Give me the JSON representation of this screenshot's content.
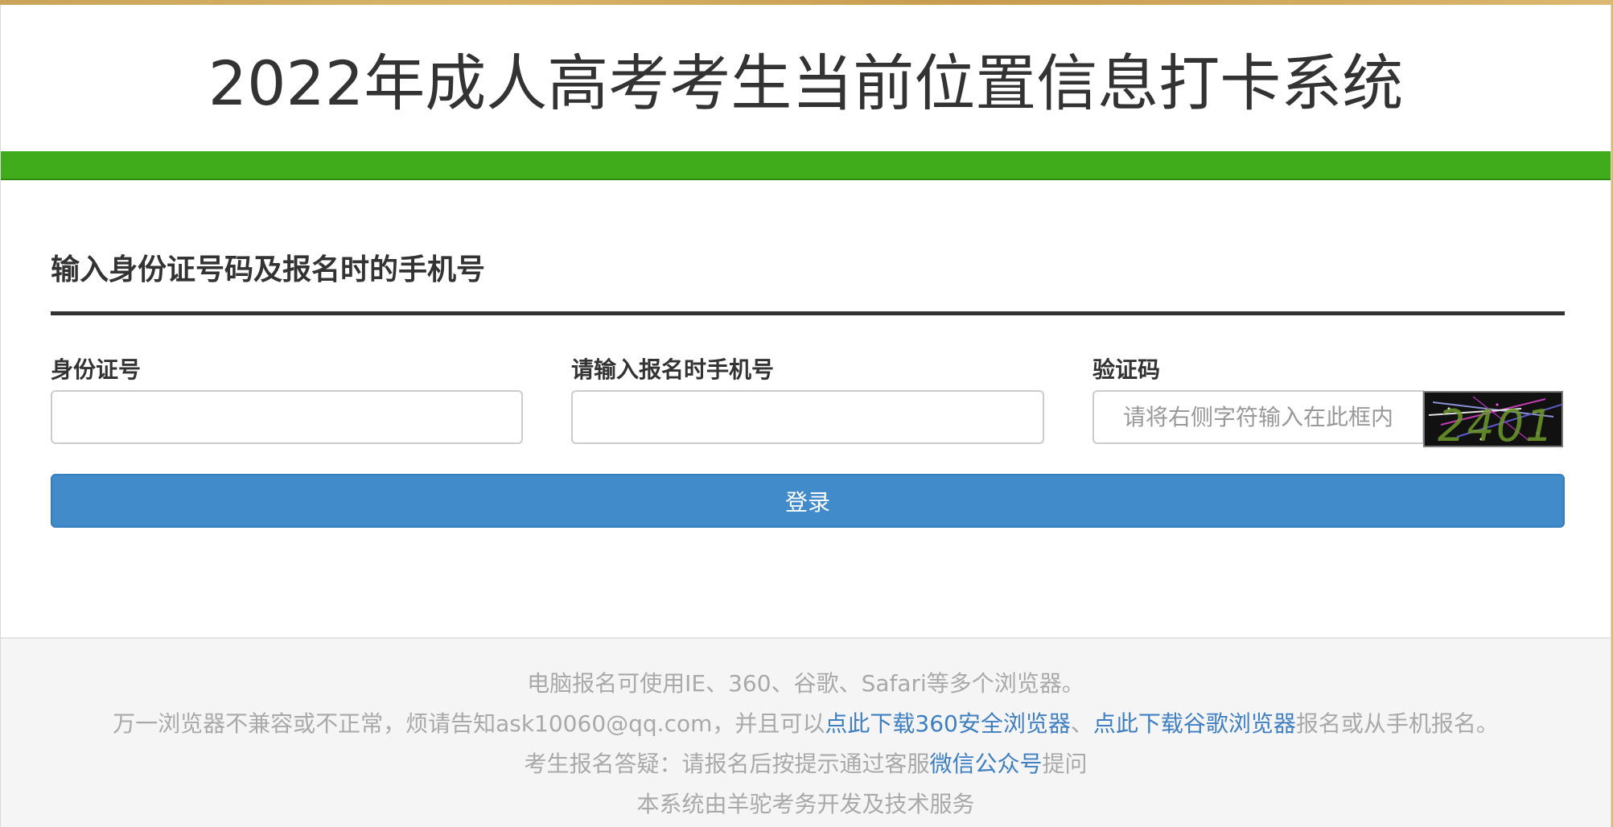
{
  "header": {
    "title": "2022年成人高考考生当前位置信息打卡系统"
  },
  "form": {
    "section_title": "输入身份证号码及报名时的手机号",
    "id_label": "身份证号",
    "phone_label": "请输入报名时手机号",
    "captcha_label": "验证码",
    "id_value": "",
    "phone_value": "",
    "captcha_placeholder": "请将右侧字符输入在此框内",
    "captcha_code": "2401",
    "login_label": "登录"
  },
  "footer": {
    "line1": "电脑报名可使用IE、360、谷歌、Safari等多个浏览器。",
    "line2_prefix": "万一浏览器不兼容或不正常，烦请告知ask10060@qq.com，并且可以",
    "line2_link1": "点此下载360安全浏览器",
    "line2_sep": "、",
    "line2_link2": "点此下载谷歌浏览器",
    "line2_suffix": "报名或从手机报名。",
    "line3_prefix": "考生报名答疑：请报名后按提示通过客服",
    "line3_link": "微信公众号",
    "line3_suffix": "提问",
    "line4": "本系统由羊驼考务开发及技术服务"
  },
  "colors": {
    "green_bar": "#41ac1b",
    "button": "#428bca",
    "link": "#3f7fc1"
  }
}
